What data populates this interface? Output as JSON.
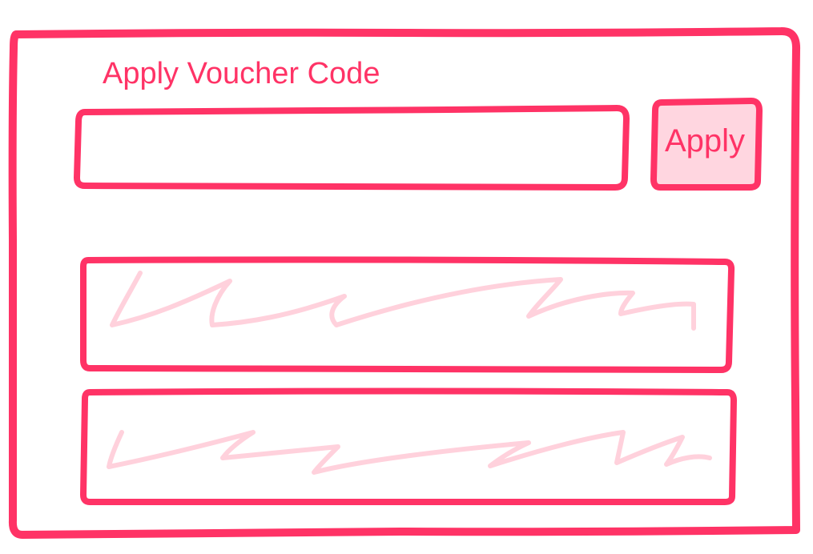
{
  "voucher": {
    "title": "Apply Voucher Code",
    "input_value": "",
    "input_placeholder": "",
    "apply_label": "Apply"
  },
  "colors": {
    "accent": "#ff3366",
    "button_fill": "#ffd6e0",
    "scribble": "#ffd1dc",
    "background": "#ffffff"
  }
}
